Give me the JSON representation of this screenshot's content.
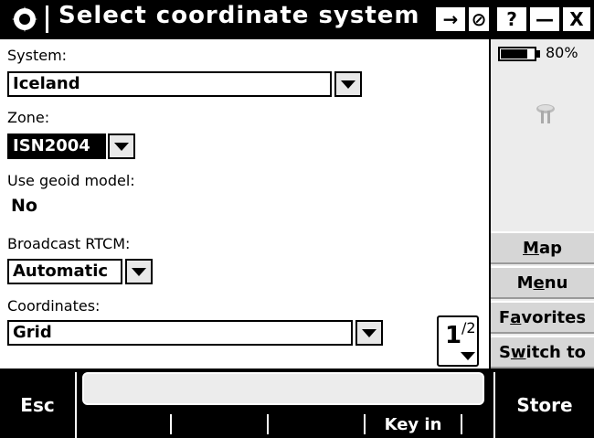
{
  "title": "Select coordinate system",
  "titlebar": {
    "app_icon": "gear-sun-icon",
    "buttons": [
      {
        "icon": "key-arrow-icon",
        "label": "→"
      },
      {
        "icon": "stop-icon",
        "label": "⊘"
      },
      {
        "icon": "help-icon",
        "label": "?"
      },
      {
        "icon": "minimize-icon",
        "label": "—"
      },
      {
        "icon": "close-icon",
        "label": "X"
      }
    ]
  },
  "form": {
    "system": {
      "label": "System:",
      "value": "Iceland"
    },
    "zone": {
      "label": "Zone:",
      "value": "ISN2004"
    },
    "geoid": {
      "label": "Use geoid model:",
      "value": "No"
    },
    "rtcm": {
      "label": "Broadcast RTCM:",
      "value": "Automatic"
    },
    "coordinates": {
      "label": "Coordinates:",
      "value": "Grid"
    }
  },
  "page_indicator": {
    "current": "1",
    "total": "/2"
  },
  "side": {
    "battery_pct": "80%",
    "battery_level": 0.8,
    "receiver_icon": "gps-receiver-icon",
    "buttons": [
      {
        "label": "Map"
      },
      {
        "label": "Menu"
      },
      {
        "label": "Favorites"
      },
      {
        "label": "Switch to"
      }
    ]
  },
  "bottom": {
    "esc": "Esc",
    "softkeys": [
      "",
      "",
      "",
      "Key in",
      ""
    ],
    "store": "Store"
  }
}
